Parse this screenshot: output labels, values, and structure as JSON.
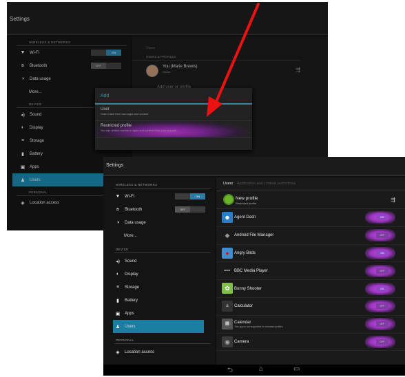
{
  "back": {
    "title": "Settings",
    "sections": {
      "wireless": "WIRELESS & NETWORKS",
      "device": "DEVICE",
      "personal": "PERSONAL"
    },
    "items": {
      "wifi": "Wi-Fi",
      "wifi_toggle": "ON",
      "bluetooth": "Bluetooth",
      "bluetooth_toggle": "OFF",
      "data_usage": "Data usage",
      "more": "More...",
      "sound": "Sound",
      "display": "Display",
      "storage": "Storage",
      "battery": "Battery",
      "apps": "Apps",
      "users": "Users",
      "location": "Location access"
    },
    "right": {
      "subtitle": "Users",
      "header": "USERS & PROFILES",
      "owner_name": "You (Marie Brewis)",
      "owner_sub": "Owner",
      "add_row": "Add user or profile"
    },
    "dialog": {
      "title": "Add",
      "user_title": "User",
      "user_desc": "Users have their own apps and content",
      "restricted_title": "Restricted profile",
      "restricted_desc": "You can restrict access to apps and content from your account"
    }
  },
  "front": {
    "title": "Settings",
    "sections": {
      "wireless": "WIRELESS & NETWORKS",
      "device": "DEVICE",
      "personal": "PERSONAL"
    },
    "items": {
      "wifi": "Wi-Fi",
      "wifi_toggle": "ON",
      "bluetooth": "Bluetooth",
      "bluetooth_toggle": "OFF",
      "data_usage": "Data usage",
      "more": "More...",
      "sound": "Sound",
      "display": "Display",
      "storage": "Storage",
      "battery": "Battery",
      "apps": "Apps",
      "users": "Users",
      "location": "Location access"
    },
    "right": {
      "tab_active": "Users",
      "tab_inactive": "Application and content restrictions",
      "profile_name": "New profile",
      "profile_sub": "Restricted profile",
      "apps": [
        {
          "name": "Agent Dash",
          "note": "",
          "toggle": "ON"
        },
        {
          "name": "Android File Manager",
          "note": "",
          "toggle": "OFF"
        },
        {
          "name": "Angry Birds",
          "note": "",
          "toggle": "ON"
        },
        {
          "name": "BBC Media Player",
          "note": "",
          "toggle": "OFF"
        },
        {
          "name": "Bunny Shooter",
          "note": "",
          "toggle": "ON"
        },
        {
          "name": "Calculator",
          "note": "",
          "toggle": "OFF"
        },
        {
          "name": "Calendar",
          "note": "This app is not supported in restricted profiles",
          "toggle": "OFF"
        },
        {
          "name": "Camera",
          "note": "",
          "toggle": "OFF"
        }
      ]
    }
  },
  "colors": {
    "accent": "#1a7ea3",
    "dialog_title": "#3fb1e0",
    "highlight": "#c23ad8",
    "arrow": "#ee1111"
  }
}
